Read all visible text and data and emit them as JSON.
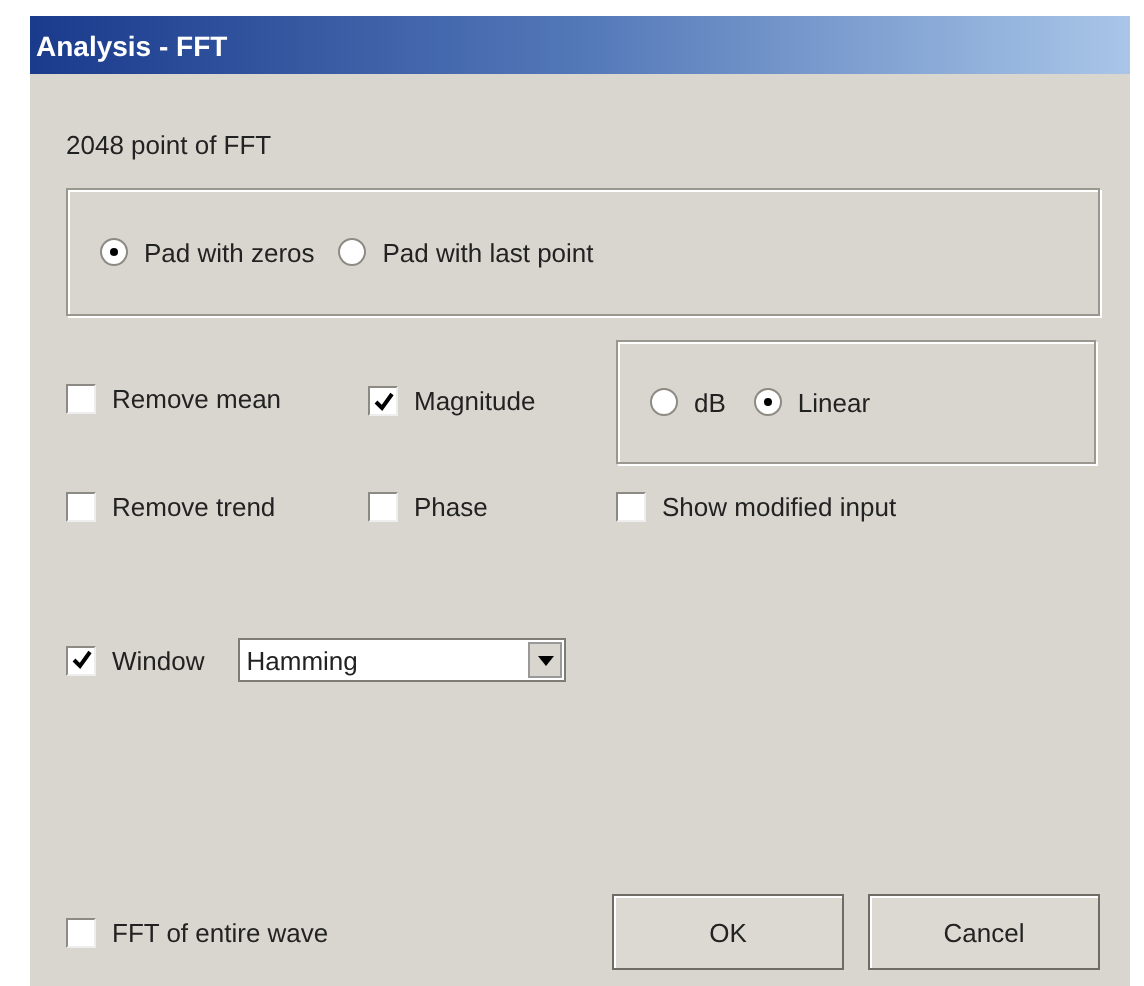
{
  "window": {
    "title": "Analysis - FFT"
  },
  "fft_points_label": "2048 point of FFT",
  "padding_options": [
    {
      "label": "Pad with zeros",
      "selected": true
    },
    {
      "label": "Pad with last point",
      "selected": false
    }
  ],
  "remove_mean": {
    "label": "Remove mean",
    "checked": false
  },
  "magnitude": {
    "label": "Magnitude",
    "checked": true
  },
  "scale_options": [
    {
      "label": "dB",
      "selected": false
    },
    {
      "label": "Linear",
      "selected": true
    }
  ],
  "remove_trend": {
    "label": "Remove trend",
    "checked": false
  },
  "phase": {
    "label": "Phase",
    "checked": false
  },
  "show_modified_input": {
    "label": "Show modified input",
    "checked": false
  },
  "window_option": {
    "label": "Window",
    "checked": true,
    "value": "Hamming"
  },
  "fft_entire_wave": {
    "label": "FFT of entire wave",
    "checked": false
  },
  "buttons": [
    "OK",
    "Cancel"
  ]
}
